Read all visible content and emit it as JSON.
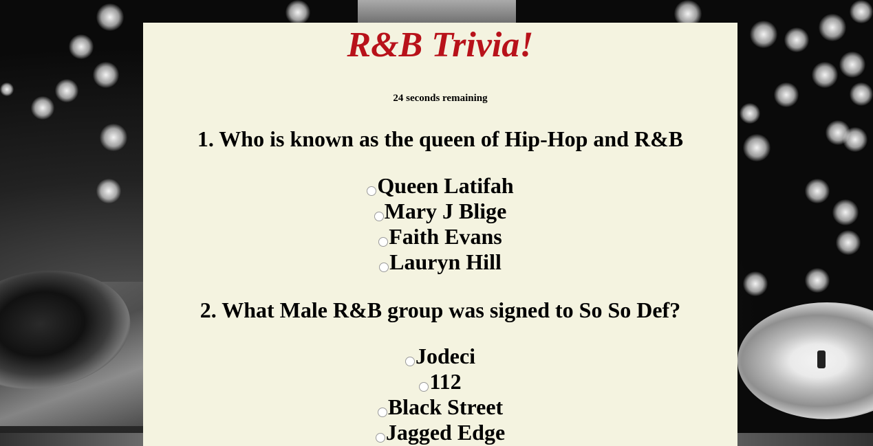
{
  "title": "R&B Trivia!",
  "timer": "24 seconds remaining",
  "questions": [
    {
      "text": "1. Who is known as the queen of Hip-Hop and R&B",
      "options": [
        "Queen Latifah",
        "Mary J Blige",
        "Faith Evans",
        "Lauryn Hill"
      ],
      "selected": null
    },
    {
      "text": "2. What Male R&B group was signed to So So Def?",
      "options": [
        "Jodeci",
        "112",
        "Black Street",
        "Jagged Edge"
      ],
      "selected": null
    }
  ],
  "colors": {
    "title": "#b8121a",
    "panel": "#f4f3e0"
  }
}
